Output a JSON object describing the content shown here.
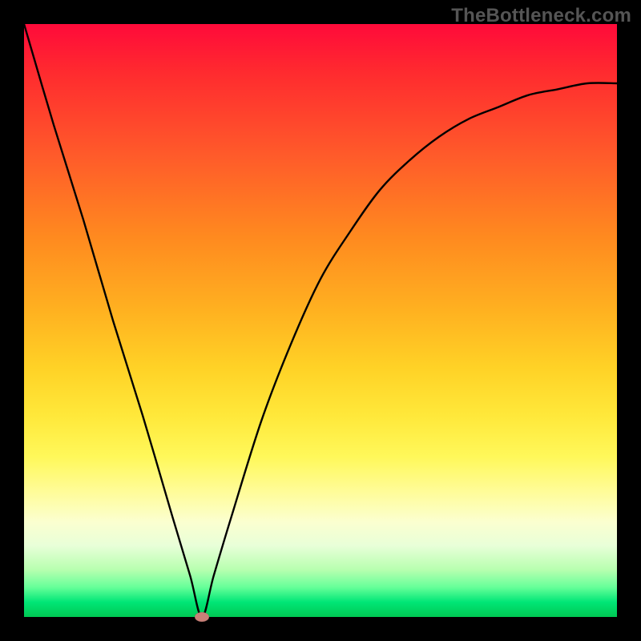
{
  "watermark": "TheBottleneck.com",
  "chart_data": {
    "type": "line",
    "title": "",
    "xlabel": "",
    "ylabel": "",
    "xlim": [
      0,
      1
    ],
    "ylim": [
      0,
      1
    ],
    "grid": false,
    "legend": false,
    "series": [
      {
        "name": "bottleneck-curve",
        "x": [
          0.0,
          0.05,
          0.1,
          0.15,
          0.2,
          0.25,
          0.28,
          0.3,
          0.32,
          0.35,
          0.4,
          0.45,
          0.5,
          0.55,
          0.6,
          0.65,
          0.7,
          0.75,
          0.8,
          0.85,
          0.9,
          0.95,
          1.0
        ],
        "y": [
          1.0,
          0.83,
          0.67,
          0.5,
          0.34,
          0.17,
          0.07,
          0.0,
          0.07,
          0.17,
          0.33,
          0.46,
          0.57,
          0.65,
          0.72,
          0.77,
          0.81,
          0.84,
          0.86,
          0.88,
          0.89,
          0.9,
          0.9
        ]
      }
    ],
    "annotations": [
      {
        "name": "minimum-marker",
        "x": 0.3,
        "y": 0.0
      }
    ],
    "background": {
      "gradient_top": "#ff0a3a",
      "gradient_bottom": "#00c853"
    },
    "frame_color": "#000000"
  }
}
